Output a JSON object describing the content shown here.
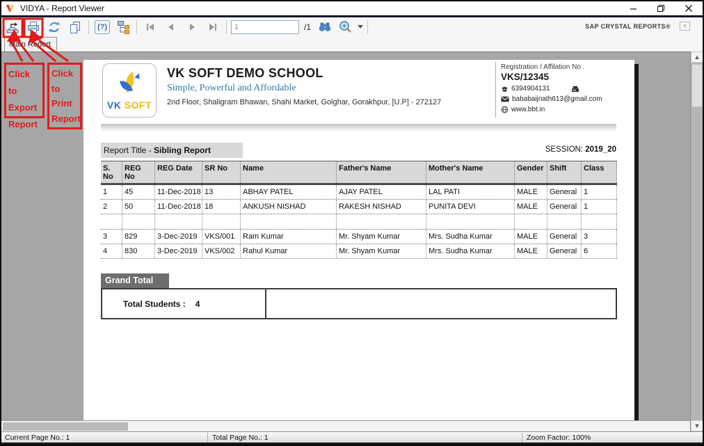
{
  "window": {
    "title": "VIDYA - Report Viewer"
  },
  "toolbar": {
    "page_value": "1",
    "page_total": "/1",
    "help_glyph": "(?)",
    "brand": "SAP CRYSTAL REPORTS®"
  },
  "tab": {
    "label": "Main Report"
  },
  "annotations": {
    "export_text": "Click to\nExport\nReport",
    "print_text": "Click\nto\nPrint\nReport"
  },
  "report": {
    "logo": {
      "vk": "VK",
      "soft": "SOFT"
    },
    "school": {
      "name": "VK SOFT DEMO SCHOOL",
      "tagline": "Simple, Powerful and Affordable",
      "address": "2nd Floor, Shaligram Bhawan, Shahi Market, Golghar, Gorakhpur, [U.P] - 272127"
    },
    "registration": {
      "label": "Registration / Affilation No .",
      "number": "VKS/12345",
      "phone": "6394904131",
      "email": "bababaijnath613@gmail.com",
      "website": "www.bbt.in"
    },
    "title_prefix": "Report Title - ",
    "title_name": "Sibling Report",
    "session_label": "SESSION: ",
    "session_value": "2019_20",
    "table": {
      "headers": [
        "S. No",
        "REG No",
        "REG Date",
        "SR No",
        "Name",
        "Father's Name",
        "Mother's Name",
        "Gender",
        "Shift",
        "Class"
      ],
      "rows": [
        {
          "cells": [
            "1",
            "45",
            "11-Dec-2018",
            "13",
            "ABHAY PATEL",
            "AJAY PATEL",
            "LAL PATI",
            "MALE",
            "General",
            "1"
          ]
        },
        {
          "cells": [
            "2",
            "50",
            "11-Dec-2018",
            "18",
            "ANKUSH NISHAD",
            "RAKESH NISHAD",
            "PUNITA DEVI",
            "MALE",
            "General",
            "1"
          ]
        },
        {
          "cells": [
            "",
            "",
            "",
            "",
            "",
            "",
            "",
            "",
            "",
            ""
          ],
          "spacer": true
        },
        {
          "cells": [
            "3",
            "829",
            "3-Dec-2019",
            "VKS/001",
            "Ram Kumar",
            "Mr. Shyam Kumar",
            "Mrs. Sudha Kumar",
            "MALE",
            "General",
            "3"
          ]
        },
        {
          "cells": [
            "4",
            "830",
            "3-Dec-2019",
            "VKS/002",
            "Rahul Kumar",
            "Mr. Shyam Kumar",
            "Mrs. Sudha Kumar",
            "MALE",
            "General",
            "6"
          ]
        }
      ]
    },
    "grand_total": {
      "label": "Grand Total",
      "total_label": "Total Students  :",
      "total_value": "4"
    }
  },
  "statusbar": {
    "current": "Current Page No.: 1",
    "total": "Total Page No.: 1",
    "zoom": "Zoom Factor: 100%"
  },
  "colors": {
    "annotation_red": "#e11b1b",
    "tagline_blue": "#3579a8",
    "table_header_gray": "#d9d9d9",
    "grand_total_gray": "#6e6e6e",
    "viewer_background_gray": "#a6a6a6"
  }
}
